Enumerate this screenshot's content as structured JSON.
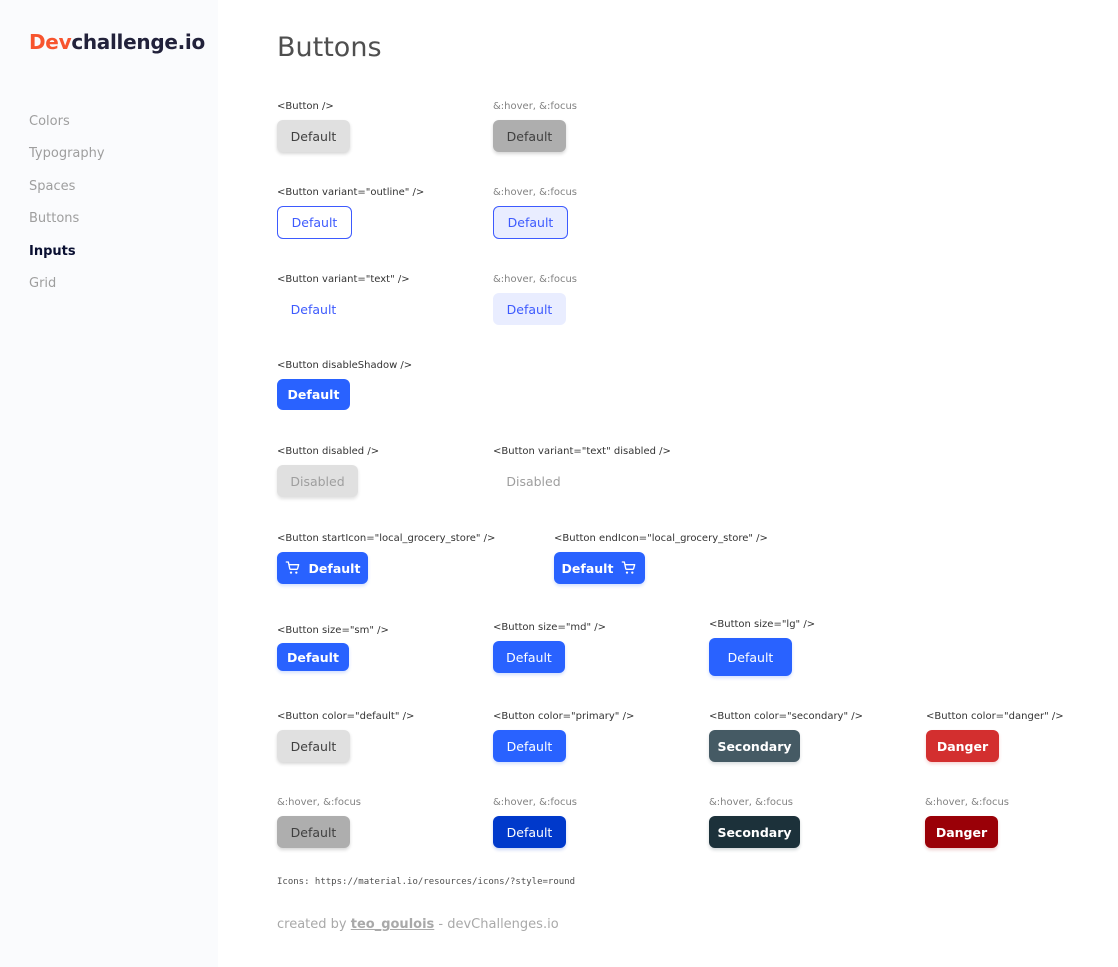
{
  "logo": {
    "accent": "Dev",
    "rest": "challenge.io"
  },
  "nav": [
    "Colors",
    "Typography",
    "Spaces",
    "Buttons",
    "Inputs",
    "Grid"
  ],
  "page_title": "Buttons",
  "hover_text": "&:hover, &:focus",
  "sections": {
    "default": {
      "label": "<Button />",
      "button": "Default"
    },
    "outline": {
      "label": "<Button variant=\"outline\" />",
      "button": "Default"
    },
    "text": {
      "label": "<Button variant=\"text\" />",
      "button": "Default"
    },
    "shadow": {
      "label": "<Button disableShadow />",
      "button": "Default"
    },
    "disabled": {
      "label": "<Button disabled />",
      "button": "Disabled",
      "text_label": "<Button variant=\"text\" disabled />",
      "text_button": "Disabled"
    },
    "icons": {
      "start_label": "<Button startIcon=\"local_grocery_store\" />",
      "end_label": "<Button endIcon=\"local_grocery_store\" />",
      "button": "Default",
      "icon": "local-grocery-store-icon"
    },
    "sizes": {
      "sm_label": "<Button size=\"sm\" />",
      "md_label": "<Button size=\"md\" />",
      "lg_label": "<Button size=\"lg\" />",
      "button": "Default"
    },
    "colors": {
      "default_label": "<Button color=\"default\" />",
      "primary_label": "<Button color=\"primary\" />",
      "secondary_label": "<Button color=\"secondary\" />",
      "danger_label": "<Button color=\"danger\" />",
      "default_button": "Default",
      "primary_button": "Default",
      "secondary_button": "Secondary",
      "danger_button": "Danger"
    }
  },
  "icons_note": "Icons: https://material.io/resources/icons/?style=round",
  "footer": {
    "prefix": "created by ",
    "author": "teo_goulois",
    "suffix": " - devChallenges.io"
  },
  "colors": {
    "brand": "#f7542e",
    "primary": "#2962ff",
    "primary_hover": "#0039cb",
    "secondary": "#455a64",
    "secondary_hover": "#1c313a",
    "danger": "#d32f2f",
    "danger_hover": "#9a0007",
    "default": "#e0e0e0",
    "default_hover": "#aeaeae"
  }
}
